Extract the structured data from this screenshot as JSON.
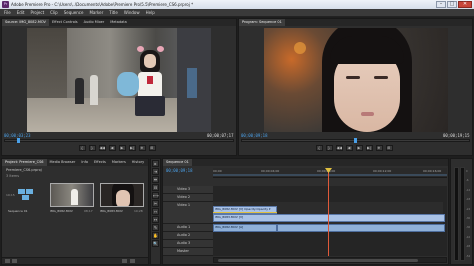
{
  "window": {
    "app_icon": "Pr",
    "title": "Adobe Premiere Pro - C:\\Users\\..\\Documents\\Adobe\\Premiere Pro\\5.5\\Premiere_CS6.prproj *",
    "minimize": "–",
    "maximize": "□",
    "close": "✕"
  },
  "menu": [
    "File",
    "Edit",
    "Project",
    "Clip",
    "Sequence",
    "Marker",
    "Title",
    "Window",
    "Help"
  ],
  "source_monitor": {
    "tabs": [
      "Source: IMG_8082.MOV",
      "Effect Controls",
      "Audio Mixer",
      "Metadata"
    ],
    "timecode_left": "00;00;03;23",
    "timecode_right": "00;00;07;17",
    "controls": [
      "{",
      "}",
      "◀◀",
      "◀",
      "▶",
      "▶|",
      "⊕",
      "⊞"
    ]
  },
  "program_monitor": {
    "tabs": [
      "Program: Sequence 01"
    ],
    "timecode_left": "00;00;09;18",
    "timecode_right": "00;00;19;15",
    "controls": [
      "{",
      "}",
      "◀◀",
      "◀",
      "▶",
      "▶|",
      "⊕",
      "⊞"
    ]
  },
  "project_panel": {
    "tabs": [
      "Project: Premiere_CS6",
      "Media Browser",
      "Info",
      "Effects",
      "Markers",
      "History"
    ],
    "project_name": "Premiere_CS6.prproj",
    "items_count": "3 Items",
    "items": [
      {
        "name": "Sequence 01",
        "meta": "19;15"
      },
      {
        "name": "IMG_8082.MOV",
        "meta": "08;17"
      },
      {
        "name": "IMG_8083.MOV",
        "meta": "10;28"
      }
    ]
  },
  "timeline": {
    "tabs": [
      "Sequence 01"
    ],
    "timecode": "00;00;09;18",
    "ruler_labels": [
      "00;00",
      "00;00;04;00",
      "00;00;08;00",
      "00;00;12;00",
      "00;00;16;00"
    ],
    "tracks": [
      "Video 3",
      "Video 2",
      "Video 1",
      "Audio 1",
      "Audio 2",
      "Audio 3",
      "Master"
    ],
    "video_clips": [
      {
        "label": "IMG_8082.MOV [V]   Opacity:Opacity ▾"
      },
      {
        "label": "IMG_8083.MOV [V]"
      }
    ],
    "audio_clips": [
      {
        "label": "IMG_8082.MOV [A]"
      },
      {
        "label": ""
      }
    ]
  },
  "tools": [
    "▸",
    "⇥",
    "⇹",
    "⊟",
    "⟷",
    "✂",
    "⇿",
    "↔",
    "✎",
    "✋",
    "🔍"
  ],
  "audio_meter": {
    "labels": [
      "0",
      "-6",
      "-12",
      "-18",
      "-24",
      "-30",
      "-36",
      "-42",
      "-48",
      "-54"
    ]
  },
  "colors": {
    "accent": "#4aa0e8",
    "playhead": "#e05a3a",
    "video_clip": "#a9c2e6",
    "audio_clip": "#8fb0d8"
  }
}
